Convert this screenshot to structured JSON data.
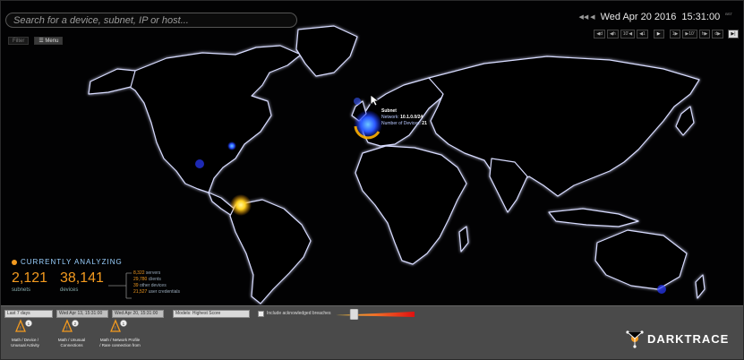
{
  "search": {
    "placeholder": "Search for a device, subnet, IP or host..."
  },
  "toolbar": {
    "filter_label": "Filter",
    "menu_label": "Menu"
  },
  "datetime": {
    "nav_arrows": "◀◀  ◀",
    "date": "Wed Apr 20 2016",
    "time": "15:31:00",
    "time_suffix": "BST"
  },
  "time_controls": [
    "◀d",
    "◀h",
    "10'◀",
    "◀1",
    "▶",
    "1▶",
    "▶10'",
    "h▶",
    "d▶",
    "▶|"
  ],
  "tooltip": {
    "title": "Subnet",
    "network_label": "Network:",
    "network": "10.1.0.0/24",
    "devices_label": "Number of Devices:",
    "devices": "21"
  },
  "analyzing": {
    "title": "CURRENTLY ANALYZING",
    "subnets_value": "2,121",
    "subnets_label": "subnets",
    "devices_value": "38,141",
    "devices_label": "devices",
    "breakdown": [
      {
        "value": "8,322",
        "label": "servers"
      },
      {
        "value": "29,780",
        "label": "clients"
      },
      {
        "value": "39",
        "label": "other devices"
      },
      {
        "value": "21,527",
        "label": "user credentials"
      }
    ]
  },
  "panel": {
    "period": "Last 7 days",
    "start": "Wed Apr 13, 15:31:00",
    "end": "Wed Apr 20, 15:31:00",
    "sort": "Models: Highest Score",
    "include_label": "Include acknowledged breaches",
    "alerts": [
      {
        "label": "Math / Device / Unusual Activity",
        "count": "1"
      },
      {
        "label": "Math / Unusual Connections",
        "count": "2"
      },
      {
        "label": "Math / Network Profile / Rare connection from",
        "count": "1"
      }
    ]
  },
  "brand": {
    "name": "DARKTRACE"
  },
  "colors": {
    "accent": "#f39a1f",
    "title_blue": "#9ad0ff",
    "map_glow": "#9fb6ff"
  }
}
